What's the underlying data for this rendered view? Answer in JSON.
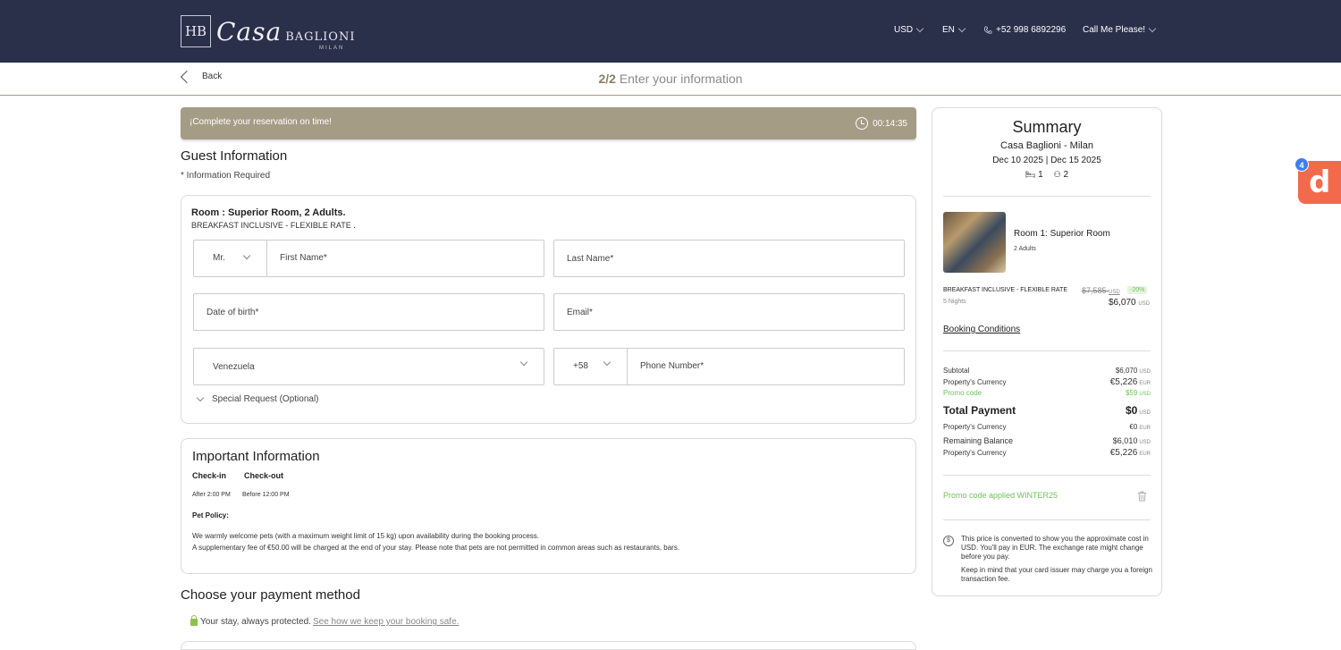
{
  "header": {
    "logo_mark": "HB",
    "logo_casa": "Casa",
    "logo_baglioni": "BAGLIONI",
    "logo_milan": "MILAN",
    "currency": "USD",
    "language": "EN",
    "phone": "+52 998 6892296",
    "call_me": "Call Me Please!"
  },
  "subbar": {
    "back": "Back",
    "step_num": "2/2",
    "step_label": "Enter your information"
  },
  "timer": {
    "message": "¡Complete your reservation on time!",
    "time": "00:14:35"
  },
  "guest": {
    "title": "Guest Information",
    "required": "* Information Required",
    "room_title": "Room : Superior Room, 2 Adults.",
    "room_rate": "BREAKFAST INCLUSIVE - FLEXIBLE RATE .",
    "title_select": "Mr.",
    "first_name_ph": "First Name*",
    "last_name_ph": "Last Name*",
    "dob_ph": "Date of birth*",
    "email_ph": "Email*",
    "country": "Venezuela",
    "dial_code": "+58",
    "phone_ph": "Phone Number*",
    "special_request": "Special Request (Optional)"
  },
  "important": {
    "title": "Important Information",
    "checkin_label": "Check-in",
    "checkout_label": "Check-out",
    "checkin_value": "After 2:00 PM",
    "checkout_value": "Before 12:00 PM",
    "pet_policy_label": "Pet Policy:",
    "pet_line1": "We warmly welcome pets (with a maximum weight limit of 15 kg) upon availability during the booking process.",
    "pet_line2": "A supplementary fee of €50.00 will be charged at the end of your stay. Please note that pets are not permitted in common areas such as restaurants, bars."
  },
  "payment": {
    "title": "Choose your payment method",
    "protected": "Your stay, always protected.",
    "protected_link": "See how we keep your booking safe."
  },
  "summary": {
    "title": "Summary",
    "hotel": "Casa Baglioni - Milan",
    "dates": "Dec 10 2025 | Dec 15 2025",
    "rooms": "1",
    "guests": "2",
    "room_name": "Room 1: Superior Room",
    "room_adults": "2 Adults",
    "rate_name": "BREAKFAST INCLUSIVE - FLEXIBLE RATE",
    "nights": "5 Nights",
    "old_price": "$7,585",
    "old_price_cur": "USD",
    "discount": "-20%",
    "new_price": "$6,070",
    "new_price_cur": "USD",
    "booking_conditions": "Booking Conditions",
    "subtotal_label": "Subtotal",
    "subtotal_value": "$6,070",
    "prop_currency_label": "Property's Currency",
    "prop_currency_value": "€5,226",
    "promo_label": "Promo code",
    "promo_value": "$59",
    "total_label": "Total Payment",
    "total_value": "$0",
    "total_prop_value": "€0",
    "remaining_label": "Remaining Balance",
    "remaining_value": "$6,010",
    "remaining_prop_value": "€5,226",
    "cur_usd": "USD",
    "cur_eur": "EUR",
    "promo_applied": "Promo code applied WINTER25",
    "note1": "This price is converted to show you the approximate cost in USD. You'll pay in EUR. The exchange rate might change before you pay.",
    "note2": "Keep in mind that your card issuer may charge you a foreign transaction fee."
  },
  "badge": {
    "count": "4",
    "letter": "d"
  },
  "colors": {
    "header_bg": "#2a2f4a",
    "accent": "#a59c86",
    "promo_green": "#6fbf5f",
    "badge_orange": "#f26a4b",
    "badge_blue": "#3f7fe8"
  }
}
